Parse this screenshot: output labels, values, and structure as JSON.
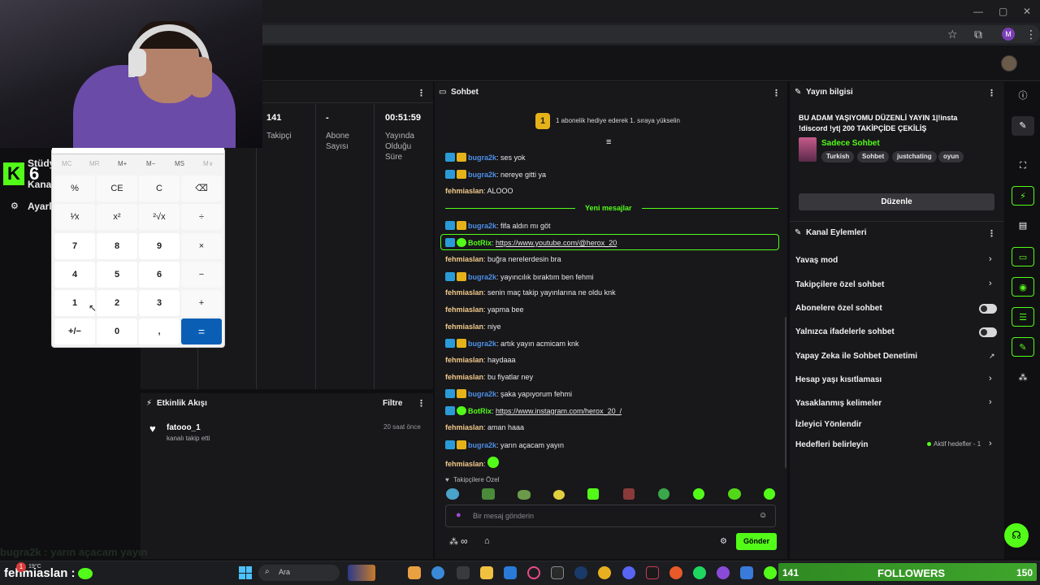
{
  "browser": {
    "avatar_letter": "M"
  },
  "overlay": {
    "kick_letter": "K",
    "kick_number": "6",
    "side_item_1": "Stüdy",
    "side_item_2": "Kanal",
    "side_item_3": "Ayarl",
    "bottom_chat_user": "bugra2k",
    "bottom_chat_text": ": yarın açacam yayın"
  },
  "stats": {
    "followers_value": "141",
    "followers_label": "Takipçi",
    "subs_value": "-",
    "subs_label": "Abone Sayısı",
    "live_value": "00:51:59",
    "live_label": "Yayında Olduğu Süre"
  },
  "events": {
    "title": "Etkinlik Akışı",
    "filter": "Filtre",
    "items": [
      {
        "user": "fatooo_1",
        "action": "kanalı takip etti",
        "time": "20 saat önce"
      }
    ]
  },
  "chat": {
    "title": "Sohbet",
    "gift_count": "1",
    "gift_text": "1 abonelik hediye ederek 1. sıraya yükselin",
    "new_messages": "Yeni mesajlar",
    "messages": [
      {
        "user": "bugra2k",
        "text": ": ses yok"
      },
      {
        "user": "bugra2k",
        "text": ": nereye gitti ya"
      },
      {
        "user": "fehmiaslan",
        "text": ": ALOOO"
      },
      {
        "user": "bugra2k",
        "text": ": fifa aldın mı göt"
      },
      {
        "user": "BotRix",
        "text": ": ",
        "link": "https://www.youtube.com/@herox_20"
      },
      {
        "user": "fehmiaslan",
        "text": ": buğra nerelerdesin bra"
      },
      {
        "user": "bugra2k",
        "text": ": yayıncılık bıraktım ben fehmi"
      },
      {
        "user": "fehmiaslan",
        "text": ": senin maç takip yayınlarına ne oldu knk"
      },
      {
        "user": "fehmiaslan",
        "text": ": yapma bee"
      },
      {
        "user": "fehmiaslan",
        "text": ": niye"
      },
      {
        "user": "bugra2k",
        "text": ": artık yayın acmicam knk"
      },
      {
        "user": "fehmiaslan",
        "text": ": haydaaa"
      },
      {
        "user": "fehmiaslan",
        "text": ": bu fiyatlar ney"
      },
      {
        "user": "bugra2k",
        "text": ": şaka yapıyorum fehmi"
      },
      {
        "user": "BotRix",
        "text": ": ",
        "link": "https://www.instagram.com/herox_20_/"
      },
      {
        "user": "fehmiaslan",
        "text": ": aman haaa"
      },
      {
        "user": "bugra2k",
        "text": ": yarın açacam yayın"
      },
      {
        "user": "fehmiaslan",
        "text": ":"
      }
    ],
    "followers_only": "Takipçilere Özel",
    "input_placeholder": "Bir mesaj gönderin",
    "send": "Gönder"
  },
  "info": {
    "title": "Yayın bilgisi",
    "stream_title": "BU ADAM YAŞIYOMU DÜZENLİ YAYIN 1|!insta !discord !yt| 200 TAKİPÇİDE ÇEKİLİŞ",
    "category": "Sadece Sohbet",
    "tags": [
      "Turkish",
      "Sohbet",
      "justchating",
      "oyun"
    ],
    "edit": "Düzenle"
  },
  "actions": {
    "title": "Kanal Eylemleri",
    "slow_mode": "Yavaş mod",
    "followers_chat": "Takipçilere özel sohbet",
    "subs_chat": "Abonelere özel sohbet",
    "emote_chat": "Yalnızca ifadelerle sohbet",
    "ai_moderation": "Yapay Zeka ile Sohbet Denetimi",
    "age_restriction": "Hesap yaşı kısıtlaması",
    "banned_words": "Yasaklanmış kelimeler",
    "redirect": "İzleyici Yönlendir",
    "goals": "Hedefleri belirleyin",
    "goals_status": "Aktif hedefler - 1"
  },
  "calculator": {
    "memory": [
      "MC",
      "MR",
      "M+",
      "M−",
      "MS",
      "M∨"
    ],
    "rows": [
      [
        "%",
        "CE",
        "C",
        "⌫"
      ],
      [
        "¹⁄x",
        "x²",
        "²√x",
        "÷"
      ],
      [
        "7",
        "8",
        "9",
        "×"
      ],
      [
        "4",
        "5",
        "6",
        "−"
      ],
      [
        "1",
        "2",
        "3",
        "+"
      ],
      [
        "+/−",
        "0",
        ",",
        "="
      ]
    ]
  },
  "taskbar": {
    "temp": "19°C",
    "search": "Ara",
    "user_overlay": "fehmiaslan :",
    "notif_count": "1"
  },
  "follower_goal": {
    "current": "141",
    "label": "FOLLOWERS",
    "target": "150"
  },
  "colors": {
    "accent": "#53fc18",
    "panel": "#18181b",
    "bg": "#0f0f11"
  }
}
